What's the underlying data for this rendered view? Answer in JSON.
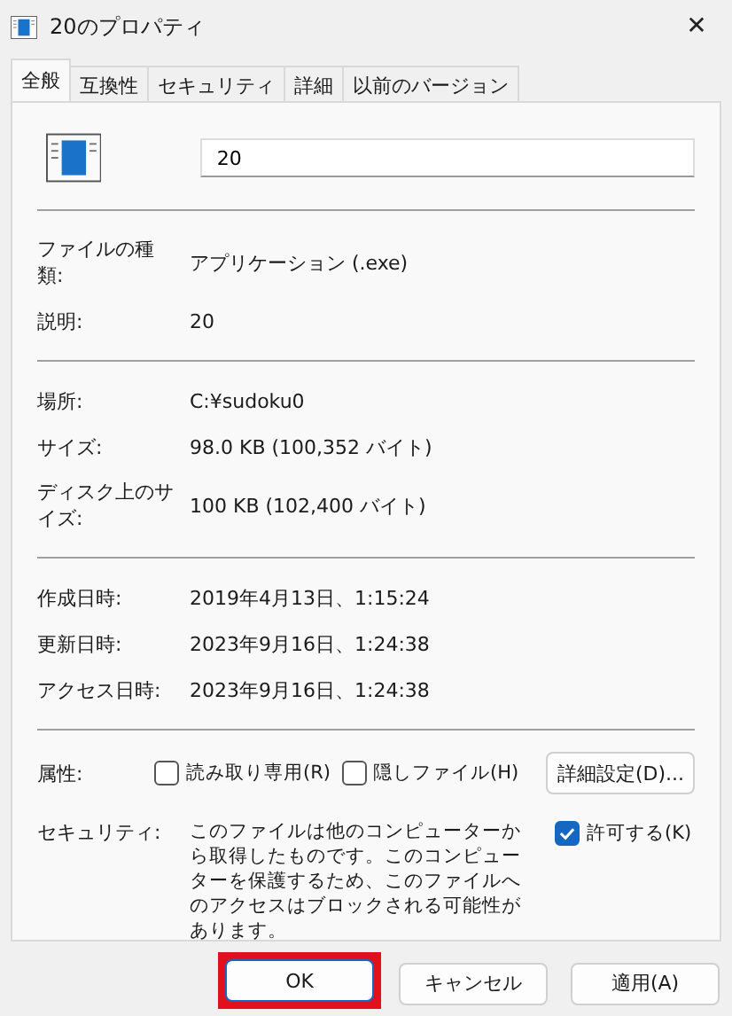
{
  "window": {
    "title": "20のプロパティ",
    "close": "✕"
  },
  "tabs": [
    {
      "label": "全般",
      "selected": true
    },
    {
      "label": "互換性",
      "selected": false
    },
    {
      "label": "セキュリティ",
      "selected": false
    },
    {
      "label": "詳細",
      "selected": false
    },
    {
      "label": "以前のバージョン",
      "selected": false
    }
  ],
  "file_name": "20",
  "sections": [
    [
      {
        "label": "ファイルの種類:",
        "value": "アプリケーション (.exe)"
      },
      {
        "label": "説明:",
        "value": "20"
      }
    ],
    [
      {
        "label": "場所:",
        "value": "C:¥sudoku0"
      },
      {
        "label": "サイズ:",
        "value": "98.0 KB (100,352 バイト)"
      },
      {
        "label": "ディスク上のサイズ:",
        "value": "100 KB (102,400 バイト)"
      }
    ],
    [
      {
        "label": "作成日時:",
        "value": "2019年4月13日、1:15:24"
      },
      {
        "label": "更新日時:",
        "value": "2023年9月16日、1:24:38"
      },
      {
        "label": "アクセス日時:",
        "value": "2023年9月16日、1:24:38"
      }
    ]
  ],
  "attributes": {
    "label": "属性:",
    "checkboxes": [
      {
        "label": "読み取り専用(R)",
        "checked": false
      },
      {
        "label": "隠しファイル(H)",
        "checked": false
      }
    ],
    "advanced_button": "詳細設定(D)..."
  },
  "security": {
    "label": "セキュリティ:",
    "message": "このファイルは他のコンピューターから取得したものです。このコンピューターを保護するため、このファイルへのアクセスはブロックされる可能性があります。",
    "allow": {
      "label": "許可する(K)",
      "checked": true
    }
  },
  "buttons": [
    {
      "label": "OK",
      "highlighted": true
    },
    {
      "label": "キャンセル",
      "highlighted": false
    },
    {
      "label": "適用(A)",
      "highlighted": false
    }
  ]
}
